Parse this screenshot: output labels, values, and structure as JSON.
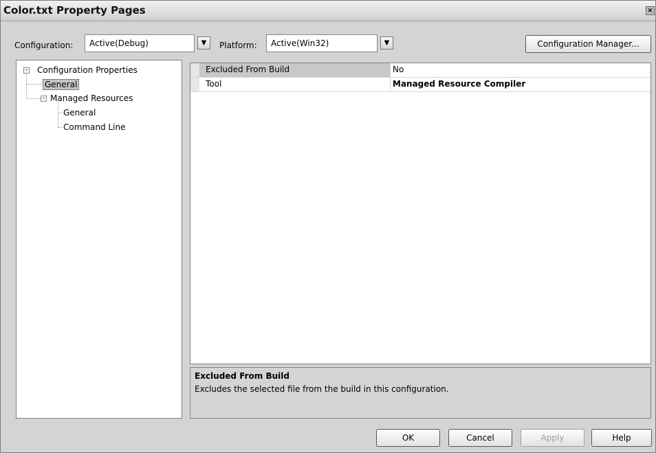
{
  "window": {
    "title": "Color.txt Property Pages",
    "close_glyph": "×"
  },
  "toolbar": {
    "configuration_label": "Configuration:",
    "configuration_value": "Active(Debug)",
    "platform_label": "Platform:",
    "platform_value": "Active(Win32)",
    "config_manager_label": "Configuration Manager..."
  },
  "tree": {
    "root": "Configuration Properties",
    "general": "General",
    "managed_resources": "Managed Resources",
    "mr_general": "General",
    "mr_command_line": "Command Line",
    "selected": "General"
  },
  "grid": {
    "rows": [
      {
        "name": "Excluded From Build",
        "value": "No",
        "highlighted": true,
        "bold": false
      },
      {
        "name": "Tool",
        "value": "Managed Resource Compiler",
        "highlighted": false,
        "bold": true
      }
    ]
  },
  "description": {
    "title": "Excluded From Build",
    "text": "Excludes the selected file from the build in this configuration."
  },
  "buttons": {
    "ok": "OK",
    "cancel": "Cancel",
    "apply": "Apply",
    "help": "Help"
  },
  "icons": {
    "dropdown": "chevron-down-icon",
    "expander": "collapse-icon",
    "close": "close-icon"
  }
}
